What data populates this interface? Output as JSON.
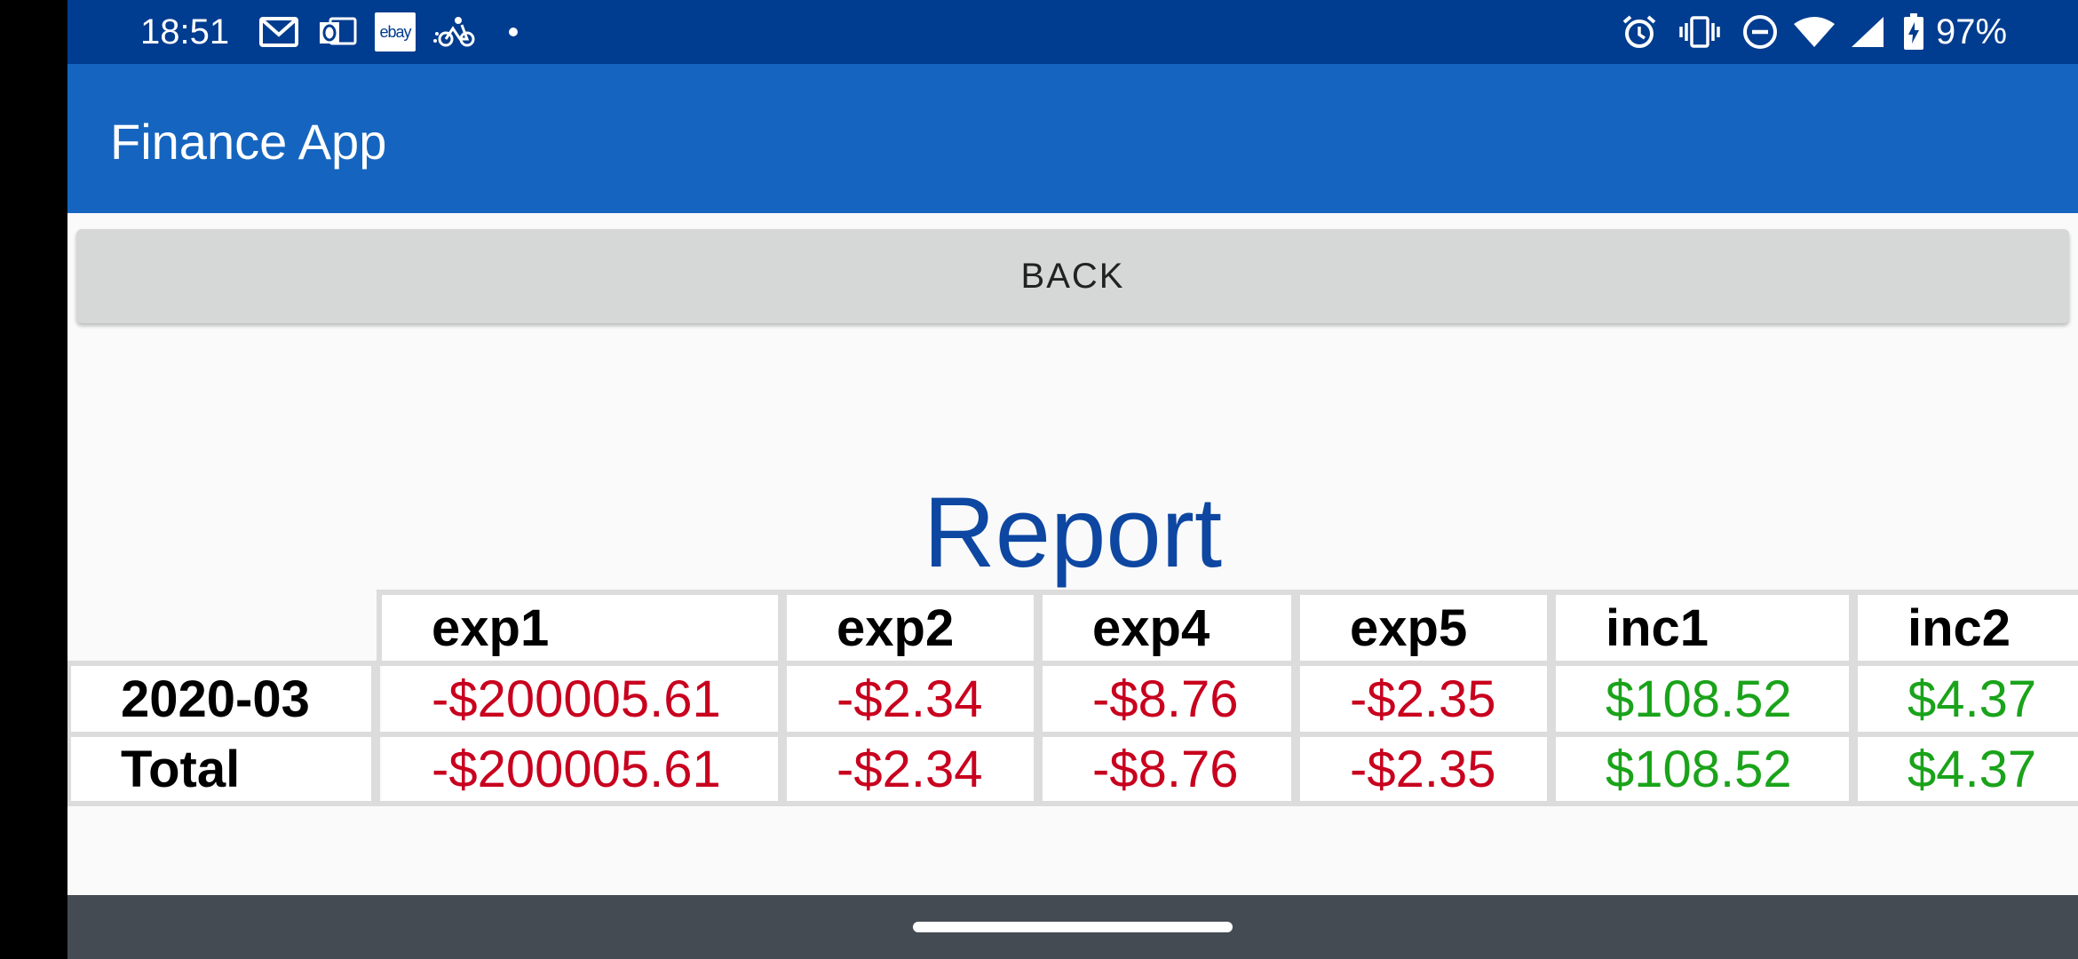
{
  "status_bar": {
    "time": "18:51",
    "left_icons": [
      "gmail-icon",
      "outlook-icon",
      "ebay-icon",
      "postmates-icon",
      "dot-icon"
    ],
    "ebay_text": "ebay",
    "right_icons": [
      "alarm-icon",
      "vibrate-icon",
      "do-not-disturb-icon",
      "wifi-icon",
      "signal-icon",
      "battery-charging-icon"
    ],
    "battery_percent": "97%",
    "color": "#003c8f"
  },
  "toolbar": {
    "title": "Finance App",
    "color": "#1565c0"
  },
  "back_button": {
    "label": "BACK"
  },
  "report": {
    "title": "Report",
    "columns": [
      "exp1",
      "exp2",
      "exp4",
      "exp5",
      "inc1",
      "inc2"
    ],
    "rows": [
      {
        "label": "2020-03",
        "values": [
          "-$200005.61",
          "-$2.34",
          "-$8.76",
          "-$2.35",
          "$108.52",
          "$4.37"
        ]
      },
      {
        "label": "Total",
        "values": [
          "-$200005.61",
          "-$2.34",
          "-$8.76",
          "-$2.35",
          "$108.52",
          "$4.37"
        ]
      }
    ],
    "negative_color": "#c8001e",
    "positive_color": "#1aa31a",
    "title_color": "#0d47a1"
  },
  "nav_bar": {
    "color": "#454b52"
  }
}
